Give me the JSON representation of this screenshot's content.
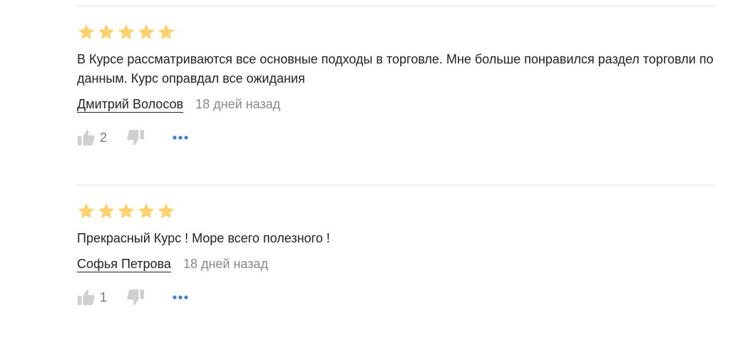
{
  "reviews": [
    {
      "rating": 5,
      "text": "В Курсе рассматриваются все основные подходы в торговле. Мне больше понравился раздел торговли по данным. Курс оправдал все ожидания",
      "author": "Дмитрий Волосов",
      "date": "18 дней назад",
      "likes": "2"
    },
    {
      "rating": 5,
      "text": "Прекрасный Курс ! Море всего полезного !",
      "author": "Софья Петрова",
      "date": "18 дней назад",
      "likes": "1"
    }
  ],
  "colors": {
    "star": "#fdd26d",
    "icon": "#cfcfcf",
    "more": "#3b7fd9",
    "divider": "#e3e4ea"
  },
  "icons": {
    "star": "star-icon",
    "like": "thumbs-up-icon",
    "dislike": "thumbs-down-icon",
    "more": "more-dots-icon"
  }
}
